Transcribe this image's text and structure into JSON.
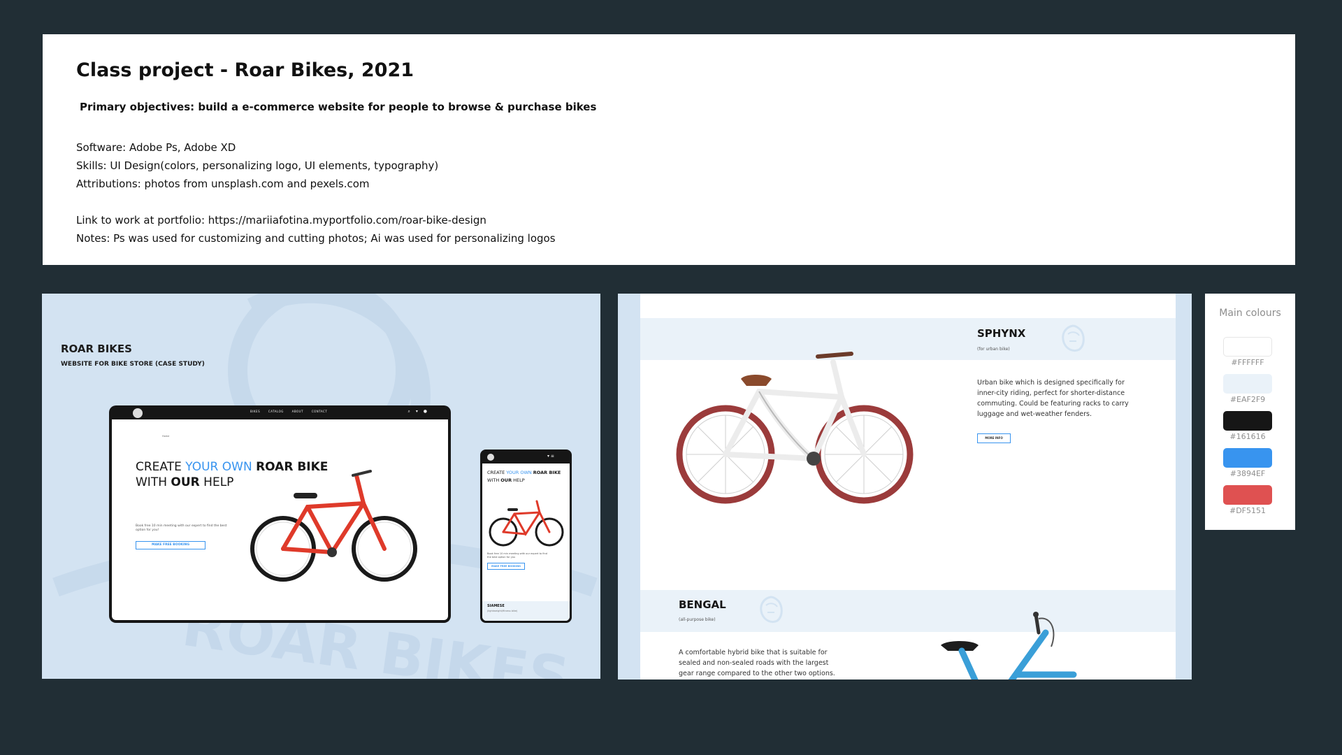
{
  "info": {
    "title": "Class project - Roar Bikes, 2021",
    "objective": "Primary objectives: build a e-commerce website for people to browse & purchase bikes",
    "software": "Software: Adobe Ps, Adobe XD",
    "skills": "Skills: UI Design(colors, personalizing logo, UI elements, typography)",
    "attributions": "Attributions: photos from unsplash.com and pexels.com",
    "link": "Link to work at portfolio: https://mariiafotina.myportfolio.com/roar-bike-design",
    "notes": "Notes: Ps was used for customizing and cutting photos; Ai was used for personalizing logos"
  },
  "mockup": {
    "brand": "ROAR BIKES",
    "subtitle": "WEBSITE FOR BIKE STORE (CASE STUDY)",
    "watermark": "ROAR BIKES",
    "nav": [
      "BIKES",
      "CATALOG",
      "ABOUT",
      "CONTACT"
    ],
    "crumb": "Home",
    "hero": {
      "create": "CREATE ",
      "your_own": "YOUR OWN ",
      "roar_bike": "ROAR BIKE",
      "with": "WITH ",
      "our": "OUR",
      "help": " HELP"
    },
    "hero_desc": "Book free 10 min meeting with our expert to find the best option for you!",
    "cta": "MAKE FREE BOOKING",
    "phone_desc": "Book free 10 min meeting with our expert to find the best option for you",
    "phone_cta": "MAKE FREE BOOKING",
    "phone_product": "SIAMESE",
    "phone_product_type": "(lightweight/fitness bike)"
  },
  "products": [
    {
      "name": "SPHYNX",
      "type": "(for urban bike)",
      "desc_lines": [
        "Urban bike which is designed specifically for",
        "inner-city riding, perfect for shorter-distance",
        "commuting. Could be featuring racks to carry",
        "luggage and wet-weather fenders."
      ],
      "button": "MORE INFO"
    },
    {
      "name": "BENGAL",
      "type": "(all-purpose bike)",
      "desc_lines": [
        "A comfortable hybrid bike that is suitable for",
        "sealed and non-sealed roads with the largest",
        "gear range compared to the other two options."
      ]
    }
  ],
  "palette": {
    "title": "Main colours",
    "colors": [
      {
        "hex": "#FFFFFF",
        "label": "#FFFFFF"
      },
      {
        "hex": "#EAF2F9",
        "label": "#EAF2F9"
      },
      {
        "hex": "#161616",
        "label": "#161616"
      },
      {
        "hex": "#3894EF",
        "label": "#3894EF"
      },
      {
        "hex": "#DF5151",
        "label": "#DF5151"
      }
    ]
  }
}
